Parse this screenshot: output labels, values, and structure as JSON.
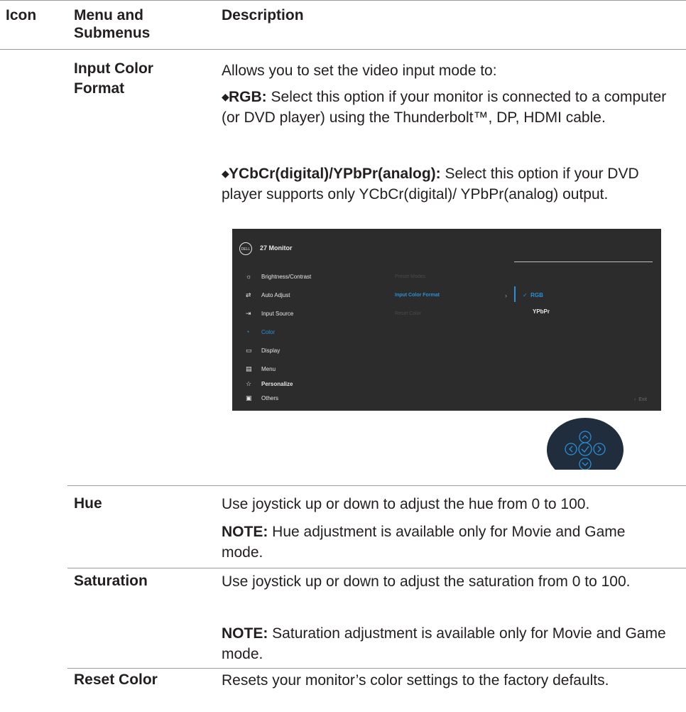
{
  "table": {
    "headers": {
      "icon": "Icon",
      "menu": "Menu and Submenus",
      "description": "Description"
    },
    "input_color_format": {
      "label": "Input Color Format",
      "intro": "Allows you to set the video input mode to:",
      "rgb_term": "RGB:",
      "rgb_text": "Select this option if your monitor is connected to a computer (or DVD player) using the Thunderbolt™, DP, HDMI cable.",
      "ycbcr_term": "YCbCr(digital)/YPbPr(analog):",
      "ycbcr_text": "Select this option if your DVD player supports only YCbCr(digital)/ YPbPr(analog) output."
    },
    "hue": {
      "label": "Hue",
      "text": "Use joystick up or down to adjust the hue from 0 to 100.",
      "note_term": "NOTE:",
      "note_text": "Hue adjustment is available only for Movie and Game mode."
    },
    "saturation": {
      "label": "Saturation",
      "text": "Use joystick up or down to adjust the saturation from 0 to 100.",
      "note_term": "NOTE:",
      "note_text": "Saturation adjustment is available only for Movie and Game mode."
    },
    "reset_color": {
      "label": "Reset Color",
      "text": "Resets your monitor’s color settings to the factory defaults."
    }
  },
  "osd": {
    "logo": "DELL",
    "title": "27 Monitor",
    "menu": [
      {
        "label": "Brightness/Contrast",
        "icon": "sun-icon"
      },
      {
        "label": "Auto Adjust",
        "icon": "auto-adjust-icon"
      },
      {
        "label": "Input Source",
        "icon": "input-source-icon"
      },
      {
        "label": "Color",
        "icon": "color-icon"
      },
      {
        "label": "Display",
        "icon": "display-icon"
      },
      {
        "label": "Menu",
        "icon": "menu-icon"
      },
      {
        "label": "Personalize",
        "icon": "star-icon"
      },
      {
        "label": "Others",
        "icon": "others-icon"
      }
    ],
    "submenu": [
      "Preset Modes",
      "Input Color Format",
      "Reset Color"
    ],
    "options": [
      "RGB",
      "YPbPr"
    ],
    "exit": "Exit",
    "accent": "#2a8fd6",
    "background": "#2c2c2c"
  }
}
